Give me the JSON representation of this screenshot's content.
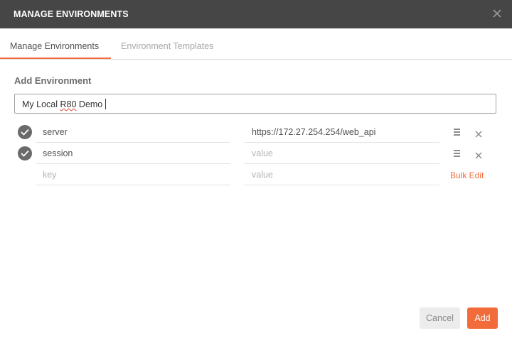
{
  "dialog": {
    "title": "MANAGE ENVIRONMENTS"
  },
  "tabs": [
    {
      "label": "Manage Environments",
      "active": true
    },
    {
      "label": "Environment Templates",
      "active": false
    }
  ],
  "form": {
    "section_title": "Add Environment",
    "env_name_prefix": "My Local ",
    "env_name_typo": "R80",
    "env_name_suffix": " Demo"
  },
  "variables": [
    {
      "enabled": true,
      "key": "server",
      "value": "https://172.27.254.254/web_api",
      "value_placeholder": ""
    },
    {
      "enabled": true,
      "key": "session",
      "value": "",
      "value_placeholder": "value"
    }
  ],
  "new_row": {
    "key_placeholder": "key",
    "value_placeholder": "value",
    "bulk_edit_label": "Bulk Edit"
  },
  "footer": {
    "cancel_label": "Cancel",
    "add_label": "Add"
  },
  "colors": {
    "accent": "#f26b3a",
    "titlebar": "#464646"
  },
  "icons": [
    "close-icon",
    "check-icon",
    "menu-icon",
    "delete-icon"
  ]
}
